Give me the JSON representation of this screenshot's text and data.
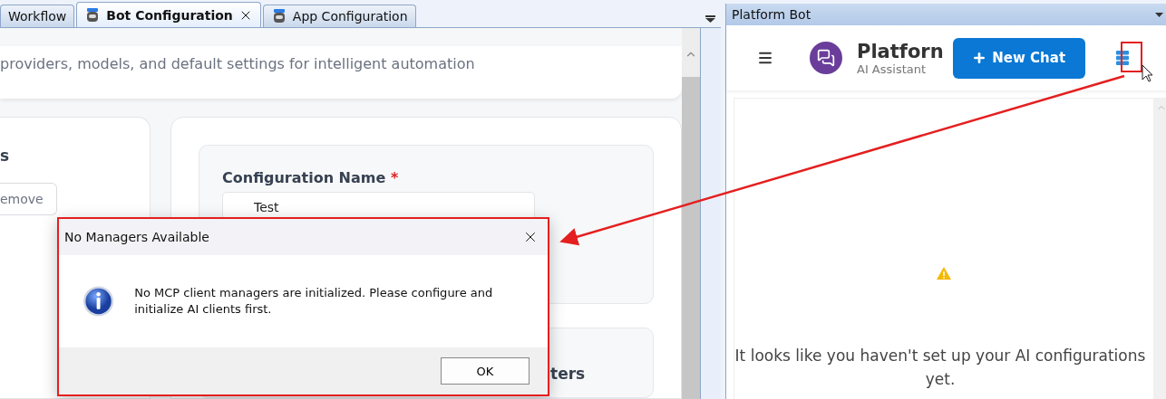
{
  "tabs": [
    {
      "label": "Workflow",
      "selected": false,
      "icon": false,
      "closable": false
    },
    {
      "label": "Bot Configuration",
      "selected": true,
      "icon": true,
      "closable": true
    },
    {
      "label": "App Configuration",
      "selected": false,
      "icon": true,
      "closable": false
    }
  ],
  "header": {
    "subtitle": "providers, models, and default settings for intelligent automation"
  },
  "left_card": {
    "heading": "s",
    "button": "emove"
  },
  "form": {
    "field_label": "Configuration Name",
    "required_mark": "*",
    "field_value": "Test",
    "section_heading": "ters"
  },
  "side_panel": {
    "title": "Platform Bot",
    "brand": "Platforn",
    "tagline": "AI Assistant",
    "new_chat": "New Chat",
    "empty_message": "It looks like you haven't set up your AI configurations yet."
  },
  "dialog": {
    "title": "No Managers Available",
    "message": "No MCP client managers are initialized. Please configure and initialize AI clients first.",
    "button": "OK"
  }
}
